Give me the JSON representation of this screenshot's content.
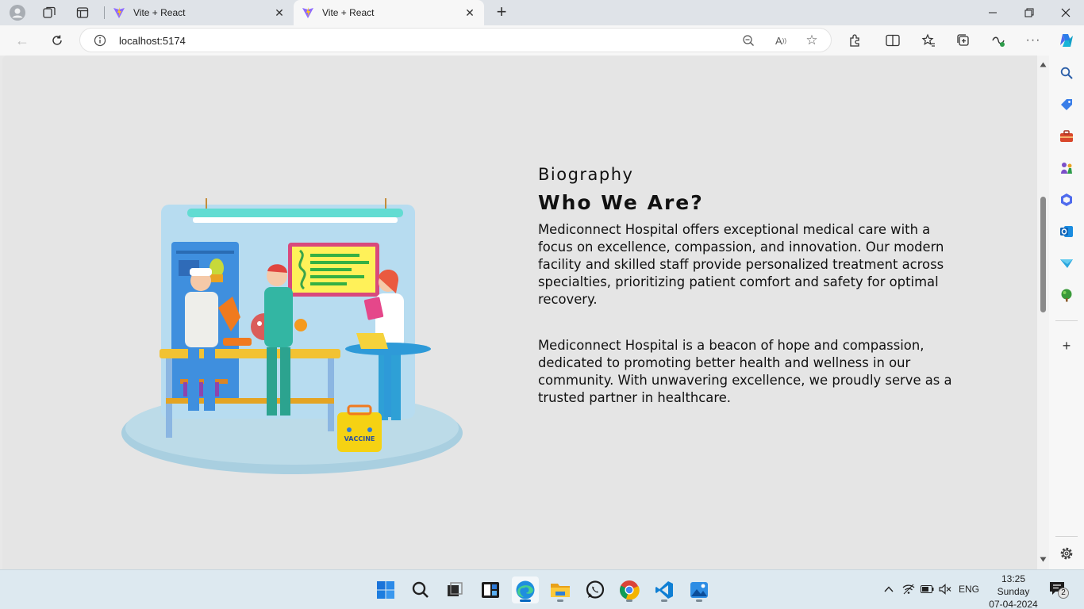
{
  "browser": {
    "tabs": [
      {
        "title": "Vite + React",
        "active": false
      },
      {
        "title": "Vite + React",
        "active": true
      }
    ],
    "new_tab_label": "+",
    "address": "localhost:5174",
    "window_controls": [
      "minimize-icon",
      "restore-icon",
      "close-icon"
    ],
    "toolbar_icons": [
      "zoom-out-icon",
      "read-aloud-icon",
      "favorite-star-icon",
      "extensions-icon",
      "split-screen-icon",
      "favorites-icon",
      "collections-icon",
      "browser-essentials-icon",
      "more-icon",
      "copilot-icon"
    ],
    "sidebar_icons": [
      "search-icon",
      "shopping-tag-icon",
      "tools-icon",
      "games-icon",
      "microsoft-365-icon",
      "outlook-icon",
      "drop-icon",
      "tree-icon",
      "add-icon",
      "settings-icon"
    ]
  },
  "page": {
    "eyebrow": "Biography",
    "heading": "Who We Are?",
    "paragraph1": "Mediconnect Hospital offers exceptional medical care with a focus on excellence, compassion, and innovation. Our modern facility and skilled staff provide personalized treatment across specialties, prioritizing patient comfort and safety for optimal recovery.",
    "paragraph2": "Mediconnect Hospital is a beacon of hope and compassion, dedicated to promoting better health and wellness in our community. With unwavering excellence, we proudly serve as a trusted partner in healthcare.",
    "illustration_label": "VACCINE"
  },
  "taskbar": {
    "apps": [
      "windows-start-icon",
      "search-icon",
      "task-view-icon",
      "widgets-icon",
      "edge-icon",
      "file-explorer-icon",
      "whatsapp-icon",
      "chrome-icon",
      "vscode-icon",
      "photos-icon"
    ],
    "language": "ENG",
    "time": "13:25",
    "day": "Sunday",
    "date": "07-04-2024",
    "notification_count": "2"
  },
  "colors": {
    "accent": "#0067c0",
    "page_background": "#e5e5e5",
    "text": "#111111"
  }
}
